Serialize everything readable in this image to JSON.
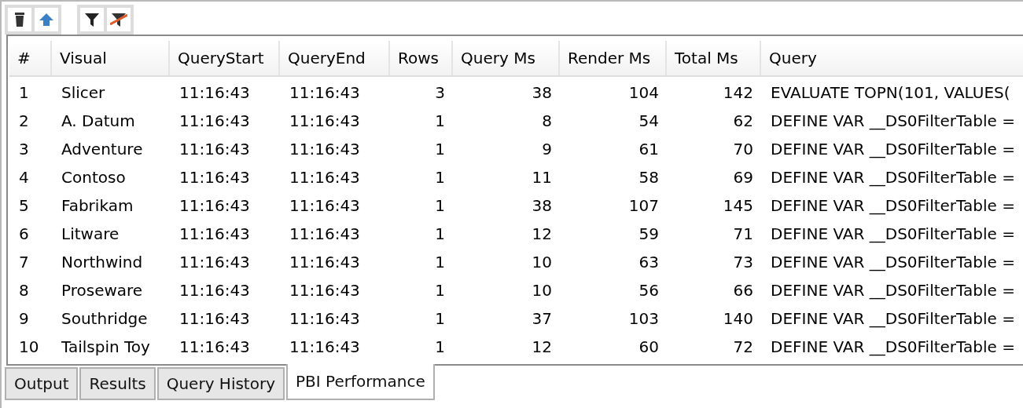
{
  "toolbar": {
    "groups": [
      {
        "buttons": [
          {
            "kind": "trash"
          },
          {
            "kind": "up"
          }
        ]
      },
      {
        "buttons": [
          {
            "kind": "filter"
          },
          {
            "kind": "clear-filter"
          }
        ]
      }
    ]
  },
  "table": {
    "columns": [
      "#",
      "Visual",
      "QueryStart",
      "QueryEnd",
      "Rows",
      "Query Ms",
      "Render Ms",
      "Total Ms",
      "Query"
    ],
    "rows": [
      [
        "1",
        "Slicer",
        "11:16:43",
        "11:16:43",
        "3",
        "38",
        "104",
        "142",
        "EVALUATE TOPN(101, VALUES("
      ],
      [
        "2",
        "A. Datum",
        "11:16:43",
        "11:16:43",
        "1",
        "8",
        "54",
        "62",
        "DEFINE VAR __DS0FilterTable ="
      ],
      [
        "3",
        "Adventure",
        "11:16:43",
        "11:16:43",
        "1",
        "9",
        "61",
        "70",
        "DEFINE VAR __DS0FilterTable ="
      ],
      [
        "4",
        "Contoso",
        "11:16:43",
        "11:16:43",
        "1",
        "11",
        "58",
        "69",
        "DEFINE VAR __DS0FilterTable ="
      ],
      [
        "5",
        "Fabrikam",
        "11:16:43",
        "11:16:43",
        "1",
        "38",
        "107",
        "145",
        "DEFINE VAR __DS0FilterTable ="
      ],
      [
        "6",
        "Litware",
        "11:16:43",
        "11:16:43",
        "1",
        "12",
        "59",
        "71",
        "DEFINE VAR __DS0FilterTable ="
      ],
      [
        "7",
        "Northwind",
        "11:16:43",
        "11:16:43",
        "1",
        "10",
        "63",
        "73",
        "DEFINE VAR __DS0FilterTable ="
      ],
      [
        "8",
        "Proseware",
        "11:16:43",
        "11:16:43",
        "1",
        "10",
        "56",
        "66",
        "DEFINE VAR __DS0FilterTable ="
      ],
      [
        "9",
        "Southridge",
        "11:16:43",
        "11:16:43",
        "1",
        "37",
        "103",
        "140",
        "DEFINE VAR __DS0FilterTable ="
      ],
      [
        "10",
        "Tailspin Toy",
        "11:16:43",
        "11:16:43",
        "1",
        "12",
        "60",
        "72",
        "DEFINE VAR __DS0FilterTable ="
      ]
    ]
  },
  "tabs": [
    {
      "label": "Output",
      "selected": false
    },
    {
      "label": "Results",
      "selected": false
    },
    {
      "label": "Query History",
      "selected": false
    },
    {
      "label": "PBI Performance",
      "selected": true
    }
  ]
}
